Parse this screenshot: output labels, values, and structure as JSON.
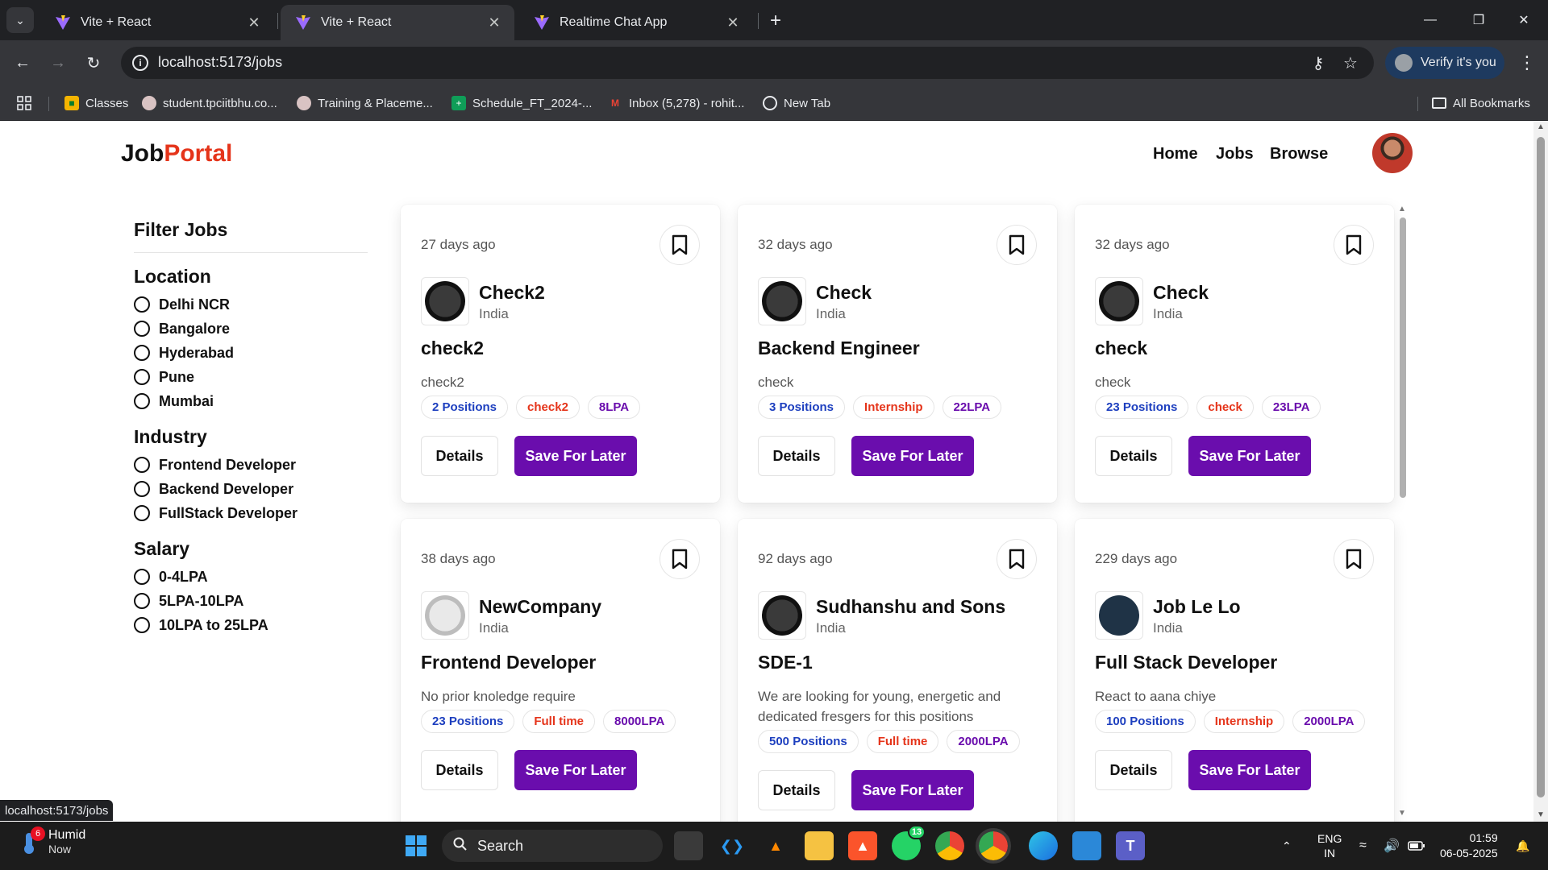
{
  "browser": {
    "tabs": [
      {
        "title": "Vite + React",
        "active": false
      },
      {
        "title": "Vite + React",
        "active": true
      },
      {
        "title": "Realtime Chat App",
        "active": false
      }
    ],
    "url": "localhost:5173/jobs",
    "verify_label": "Verify it's you",
    "bookmarks": [
      "Classes",
      "student.tpciitbhu.co...",
      "Training & Placeme...",
      "Schedule_FT_2024-...",
      "Inbox (5,278) - rohit...",
      "New Tab"
    ],
    "all_bookmarks": "All Bookmarks",
    "status_url": "localhost:5173/jobs"
  },
  "header": {
    "logo_part1": "Job",
    "logo_part2": "Portal",
    "nav": [
      "Home",
      "Jobs",
      "Browse"
    ]
  },
  "filter": {
    "title": "Filter Jobs",
    "groups": [
      {
        "name": "Location",
        "options": [
          "Delhi NCR",
          "Bangalore",
          "Hyderabad",
          "Pune",
          "Mumbai"
        ]
      },
      {
        "name": "Industry",
        "options": [
          "Frontend Developer",
          "Backend Developer",
          "FullStack Developer"
        ]
      },
      {
        "name": "Salary",
        "options": [
          "0-4LPA",
          "5LPA-10LPA",
          "10LPA to 25LPA"
        ]
      }
    ]
  },
  "jobs": [
    {
      "age": "27 days ago",
      "company": "Check2",
      "location": "India",
      "title": "check2",
      "description": "check2",
      "positions": "2 Positions",
      "type": "check2",
      "salary": "8LPA"
    },
    {
      "age": "32 days ago",
      "company": "Check",
      "location": "India",
      "title": "Backend Engineer",
      "description": "check",
      "positions": "3 Positions",
      "type": "Internship",
      "salary": "22LPA"
    },
    {
      "age": "32 days ago",
      "company": "Check",
      "location": "India",
      "title": "check",
      "description": "check",
      "positions": "23 Positions",
      "type": "check",
      "salary": "23LPA"
    },
    {
      "age": "38 days ago",
      "company": "NewCompany",
      "location": "India",
      "title": "Frontend Developer",
      "description": "No prior knoledge require",
      "positions": "23 Positions",
      "type": "Full time",
      "salary": "8000LPA"
    },
    {
      "age": "92 days ago",
      "company": "Sudhanshu and Sons",
      "location": "India",
      "title": "SDE-1",
      "description": "We are looking for young, energetic and dedicated fresgers for this positions",
      "positions": "500 Positions",
      "type": "Full time",
      "salary": "2000LPA"
    },
    {
      "age": "229 days ago",
      "company": "Job Le Lo",
      "location": "India",
      "title": "Full Stack Developer",
      "description": "React to aana chiye",
      "positions": "100 Positions",
      "type": "Internship",
      "salary": "2000LPA"
    }
  ],
  "buttons": {
    "details": "Details",
    "save": "Save For Later"
  },
  "taskbar": {
    "weather_title": "Humid",
    "weather_sub": "Now",
    "weather_badge": "6",
    "search": "Search",
    "whatsapp_badge": "13",
    "lang1": "ENG",
    "lang2": "IN",
    "time": "01:59",
    "date": "06-05-2025"
  },
  "colors": {
    "accent": "#6a0dad",
    "logo_accent": "#e5341a",
    "badge_blue": "#1d3fbf",
    "badge_red": "#e5341a",
    "badge_purple": "#6a0dad"
  }
}
